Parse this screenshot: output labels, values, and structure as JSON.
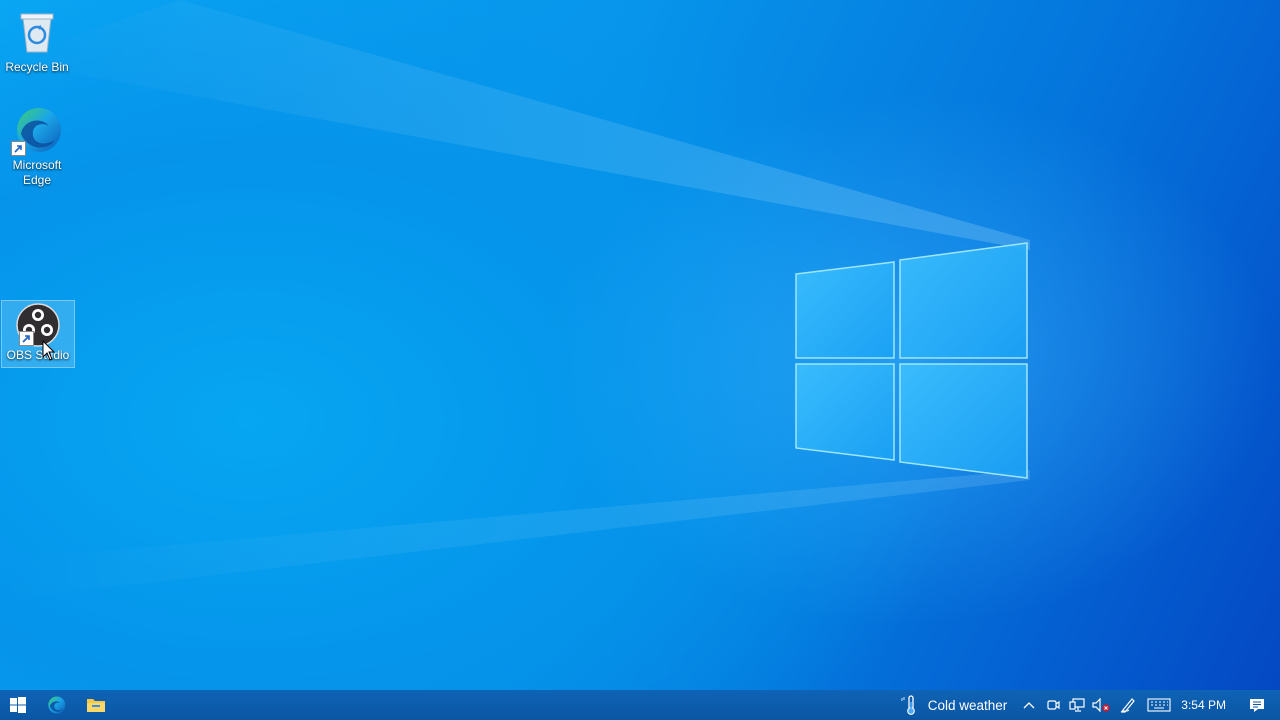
{
  "desktop": {
    "icons": [
      {
        "label": "Recycle Bin",
        "icon": "recycle-bin-icon"
      },
      {
        "label": "Microsoft Edge",
        "icon": "edge-icon"
      },
      {
        "label": "OBS Studio",
        "icon": "obs-icon"
      }
    ]
  },
  "taskbar": {
    "start": {
      "icon": "windows-start-icon"
    },
    "pinned": [
      {
        "name": "Microsoft Edge",
        "icon": "edge-icon"
      },
      {
        "name": "File Explorer",
        "icon": "folder-icon"
      }
    ],
    "tray": {
      "weather_text": "Cold weather",
      "clock": "3:54 PM"
    }
  },
  "colors": {
    "taskbar": "#0a56a4",
    "desktop_accent": "#0795eb"
  }
}
